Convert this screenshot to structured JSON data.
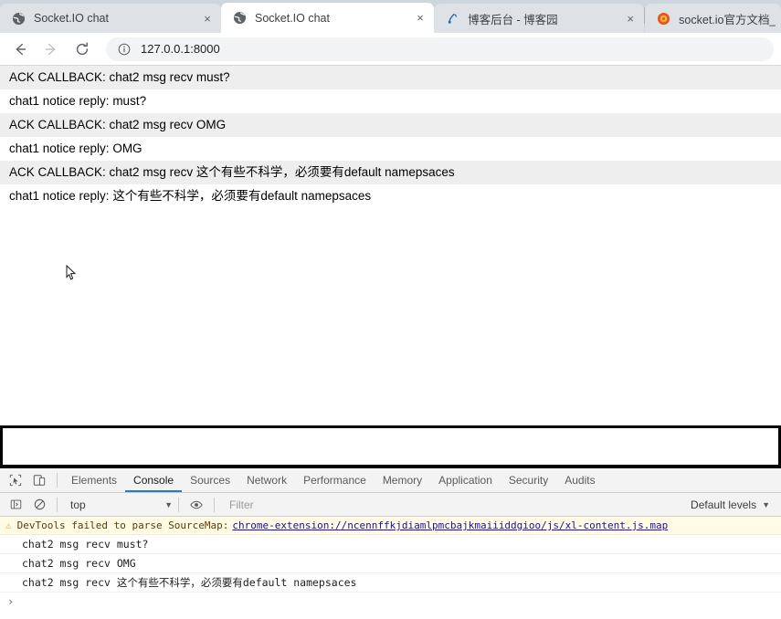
{
  "browser": {
    "tabs": [
      {
        "title": "Socket.IO chat",
        "favicon": "globe-icon",
        "active": false,
        "close_label": "×"
      },
      {
        "title": "Socket.IO chat",
        "favicon": "globe-icon",
        "active": true,
        "close_label": "×"
      },
      {
        "title": "博客后台 - 博客园",
        "favicon": "cnblogs-icon",
        "active": false,
        "close_label": "×"
      },
      {
        "title": "socket.io官方文档_w",
        "favicon": "csdn-icon",
        "active": false,
        "close_label": "×"
      }
    ],
    "toolbar": {
      "back_icon": "back-arrow-icon",
      "forward_icon": "forward-arrow-icon",
      "reload_icon": "reload-icon",
      "info_icon": "info-circle-icon",
      "url": "127.0.0.1:8000"
    }
  },
  "page": {
    "messages": [
      "ACK CALLBACK: chat2 msg recv must?",
      "chat1 notice reply: must?",
      "ACK CALLBACK: chat2 msg recv OMG",
      "chat1 notice reply: OMG",
      "ACK CALLBACK: chat2 msg recv 这个有些不科学，必须要有default namepsaces",
      "chat1 notice reply: 这个有些不科学，必须要有default namepsaces"
    ],
    "input": {
      "value": "",
      "placeholder": ""
    },
    "cursor_icon": "mouse-pointer-icon"
  },
  "devtools": {
    "inspect_icon": "inspect-element-icon",
    "device_icon": "device-toolbar-icon",
    "tabs": [
      {
        "label": "Elements",
        "active": false
      },
      {
        "label": "Console",
        "active": true
      },
      {
        "label": "Sources",
        "active": false
      },
      {
        "label": "Network",
        "active": false
      },
      {
        "label": "Performance",
        "active": false
      },
      {
        "label": "Memory",
        "active": false
      },
      {
        "label": "Application",
        "active": false
      },
      {
        "label": "Security",
        "active": false
      },
      {
        "label": "Audits",
        "active": false
      }
    ],
    "filterbar": {
      "sidebar_icon": "console-sidebar-icon",
      "clear_icon": "clear-console-icon",
      "context": "top",
      "context_caret": "▼",
      "eye_icon": "live-expression-eye-icon",
      "filter_placeholder": "Filter",
      "levels": "Default levels",
      "levels_caret": "▼"
    },
    "console": {
      "warning": {
        "icon": "warning-triangle-icon",
        "text": "DevTools failed to parse SourceMap:",
        "link": "chrome-extension://ncennffkjdiamlpmcbajkmaiiiddgioo/js/xl-content.js.map"
      },
      "logs": [
        "chat2 msg recv must?",
        "chat2 msg recv OMG",
        "chat2 msg recv 这个有些不科学，必须要有default namepsaces"
      ],
      "prompt": "›"
    }
  },
  "colors": {
    "tabstrip_bg": "#cdd5dd",
    "active_tab_bg": "#ffffff",
    "row_stripe": "#eeeeee",
    "devtools_tab_accent": "#1a7ec8",
    "warning_bg": "#fffbe5",
    "link": "#1a0dab"
  }
}
